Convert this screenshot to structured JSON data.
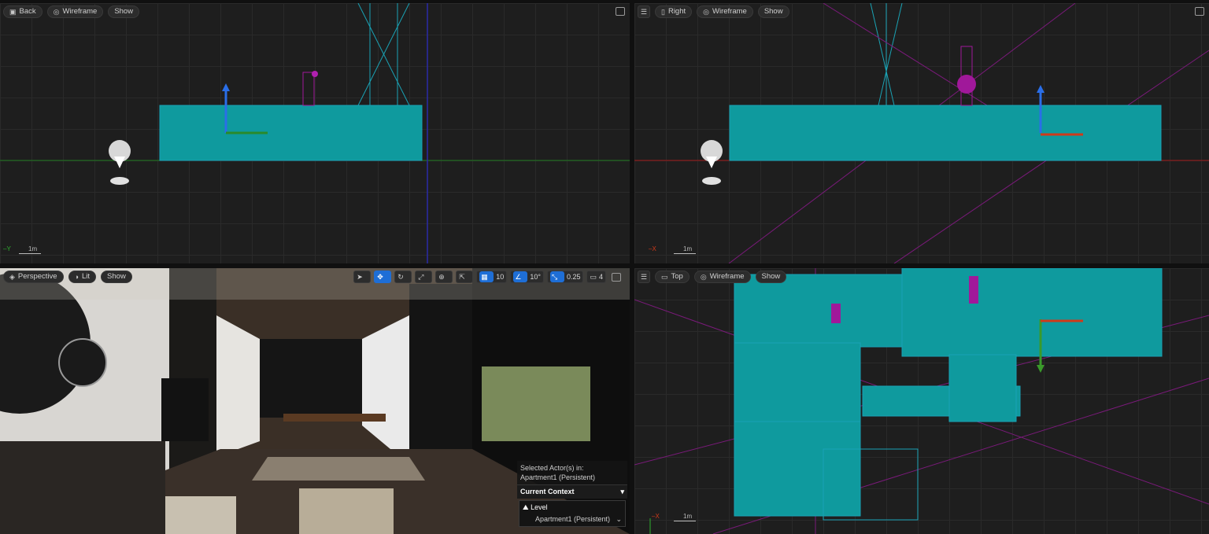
{
  "viewports": {
    "back": {
      "view_label": "Back",
      "mode_label": "Wireframe",
      "show_label": "Show",
      "scale_label": "1m",
      "axis_label": "Y"
    },
    "right": {
      "view_label": "Right",
      "mode_label": "Wireframe",
      "show_label": "Show",
      "scale_label": "1m",
      "axis_label": "X"
    },
    "perspective": {
      "view_label": "Perspective",
      "mode_label": "Lit",
      "show_label": "Show",
      "grid_snap_value": "10",
      "rotate_snap_value": "10°",
      "scale_snap_value": "0.25",
      "camera_speed_value": "4"
    },
    "top": {
      "view_label": "Top",
      "mode_label": "Wireframe",
      "show_label": "Show",
      "scale_label": "1m",
      "axis_label": "X"
    }
  },
  "context_panel": {
    "selected_label": "Selected Actor(s) in:",
    "selected_value": "Apartment1 (Persistent)",
    "current_context_label": "Current Context",
    "level_label": "Level",
    "level_value": "Apartment1 (Persistent)"
  },
  "colors": {
    "mesh_teal": "#0f9a9e",
    "wire_cyan": "#1aa3b5",
    "magenta": "#a0189a",
    "grid": "#2a2a2a",
    "accent_blue": "#1e6ed6"
  }
}
